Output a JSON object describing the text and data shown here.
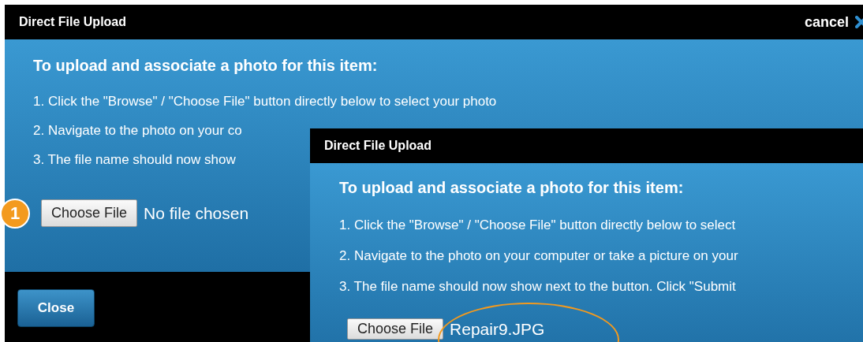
{
  "back_dialog": {
    "title": "Direct File Upload",
    "cancel": "cancel",
    "heading": "To upload and associate a photo for this item:",
    "steps": [
      "1. Click the \"Browse\" / \"Choose File\" button directly below to select your photo",
      "2. Navigate to the photo on your co",
      "3. The file name should now show"
    ],
    "file_button": "Choose File",
    "file_status": "No file chosen",
    "close_button": "Close"
  },
  "step_badge": "1",
  "front_dialog": {
    "title": "Direct File Upload",
    "heading": "To upload and associate a photo for this item:",
    "steps": [
      "1. Click the \"Browse\" / \"Choose File\" button directly below to select",
      "2. Navigate to the photo on your computer or take a picture on your",
      "3. The file name should now show next to the button. Click \"Submit"
    ],
    "file_button": "Choose File",
    "file_name": "Repair9.JPG"
  }
}
